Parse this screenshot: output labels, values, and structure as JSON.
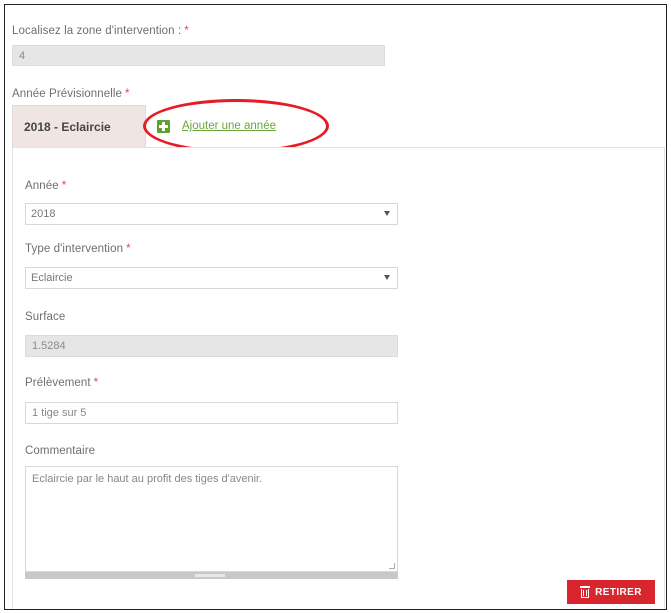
{
  "zone": {
    "label": "Localisez la zone d'intervention :",
    "required": "*",
    "value": "4"
  },
  "annee_previsionnelle": {
    "label": "Année Prévisionnelle",
    "required": "*",
    "active_tab": "2018 - Eclaircie",
    "add_year_label": "Ajouter une année"
  },
  "form": {
    "annee": {
      "label": "Année",
      "required": "*",
      "value": "2018"
    },
    "type_intervention": {
      "label": "Type d'intervention",
      "required": "*",
      "value": "Eclaircie"
    },
    "surface": {
      "label": "Surface",
      "value": "1.5284"
    },
    "prelevement": {
      "label": "Prélèvement",
      "required": "*",
      "value": "1 tige sur 5"
    },
    "commentaire": {
      "label": "Commentaire",
      "value": "Eclaircie par le haut au profit des tiges d'avenir."
    }
  },
  "actions": {
    "remove_label": "RETIRER"
  },
  "colors": {
    "required_marker": "#e0445a",
    "add_link": "#6aa73a",
    "remove_button": "#d9262e",
    "annotation_ellipse": "#e51c23"
  },
  "icons": {
    "add": "plus-square-icon",
    "remove": "trash-icon",
    "dropdown": "caret-down-icon"
  }
}
